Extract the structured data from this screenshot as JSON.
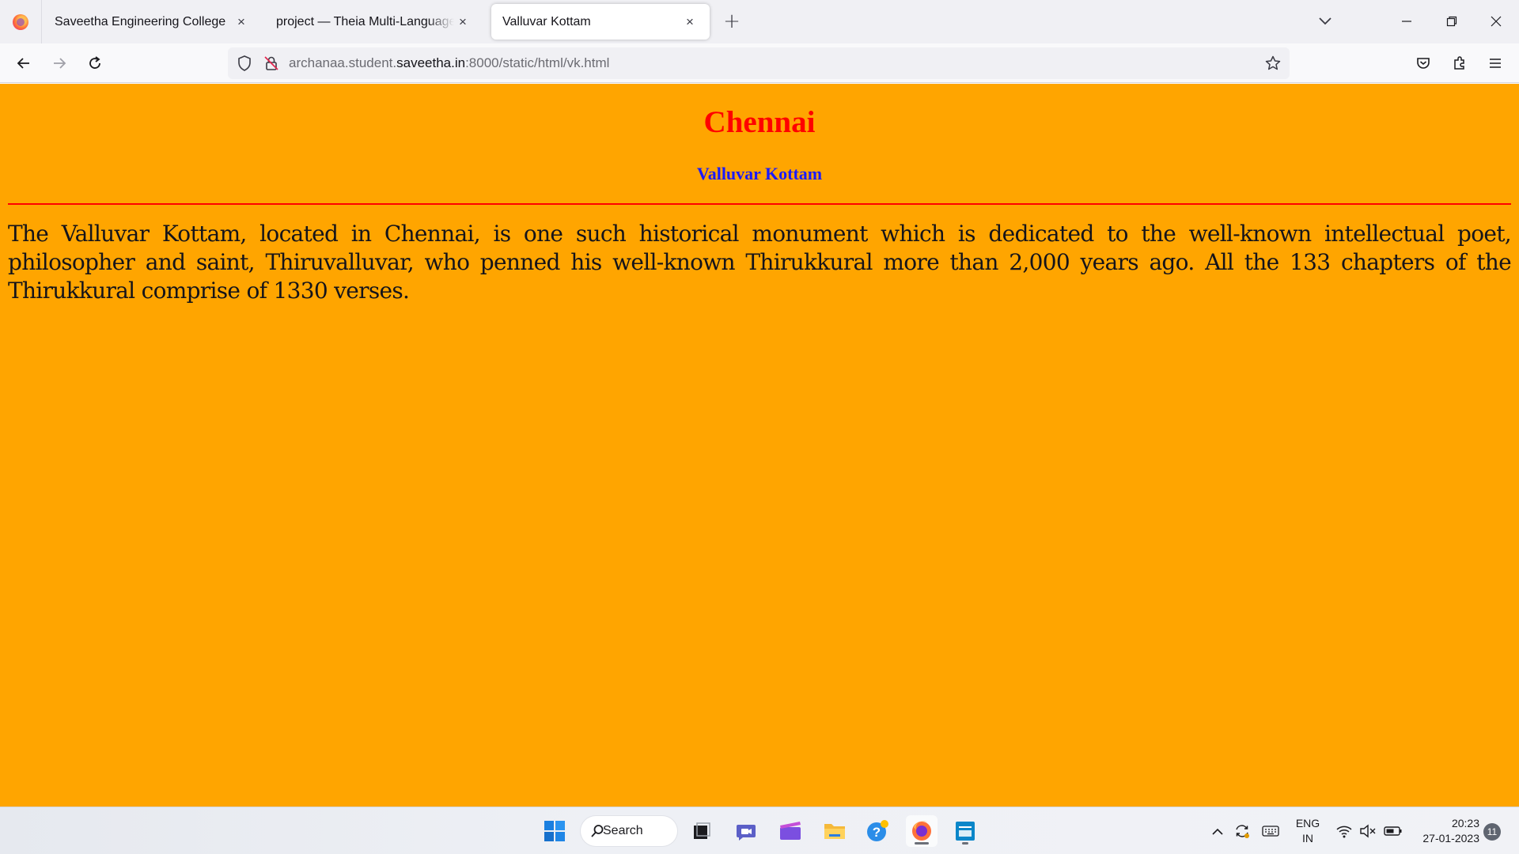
{
  "browser": {
    "tabs": [
      {
        "title": "Saveetha Engineering College",
        "close": "×"
      },
      {
        "title": "project — Theia Multi-Language Ex",
        "close": "×"
      },
      {
        "title": "Valluvar Kottam",
        "close": "×",
        "active": true
      }
    ],
    "new_tab": "+",
    "url": {
      "prefix": "archanaa.student.",
      "host": "saveetha.in",
      "suffix": ":8000/static/html/vk.html"
    }
  },
  "page": {
    "title": "Chennai",
    "subtitle": "Valluvar Kottam",
    "body": "The Valluvar Kottam, located in Chennai, is one such historical monument which is dedicated to the well-known intellectual poet, philosopher and saint, Thiruvalluvar, who penned his well-known Thirukkural more than 2,000 years ago. All the 133 chapters of the Thirukkural comprise of 1330 verses.",
    "background_color": "#ffa500",
    "title_color": "#ff0000",
    "subtitle_color": "#1a1aff"
  },
  "taskbar": {
    "search_label": "Search",
    "language": {
      "line1": "ENG",
      "line2": "IN"
    },
    "time": "20:23",
    "date": "27-01-2023",
    "notification_count": "11"
  }
}
